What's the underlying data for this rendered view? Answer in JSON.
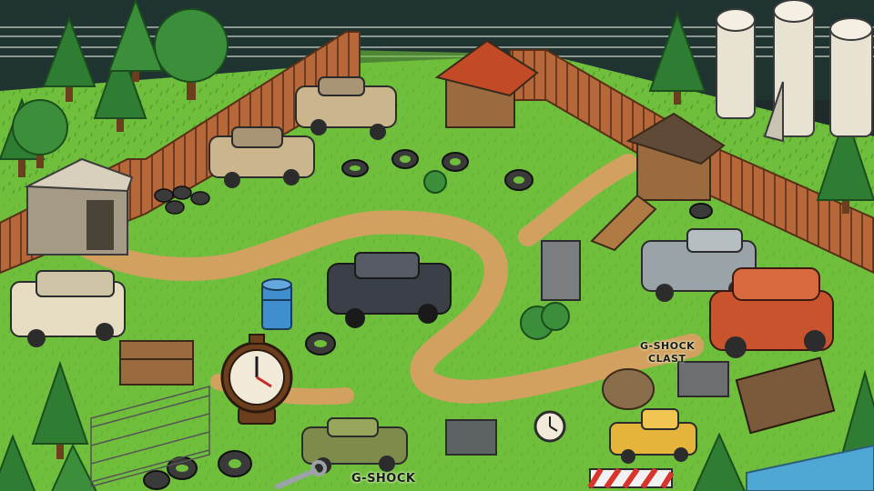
{
  "scene": {
    "label_gshock_top": "G-SHOCK",
    "label_clast": "CLAST",
    "label_gshock_bottom": "G-SHOCK"
  },
  "colors": {
    "grass": "#6fbf3c",
    "grass_dark": "#4e9a2e",
    "dirt_path": "#d2a160",
    "fence": "#b7683a",
    "sky_night": "#1f3330",
    "clock_face": "#f1ead8",
    "car_black": "#3b3f47",
    "car_red": "#c9532c",
    "barrier_red": "#d8342b"
  },
  "icons": [
    "clock-icon",
    "tire-icon",
    "wrench-icon",
    "barrel-icon",
    "tree-icon",
    "silo-icon",
    "shed-icon",
    "car-icon"
  ]
}
